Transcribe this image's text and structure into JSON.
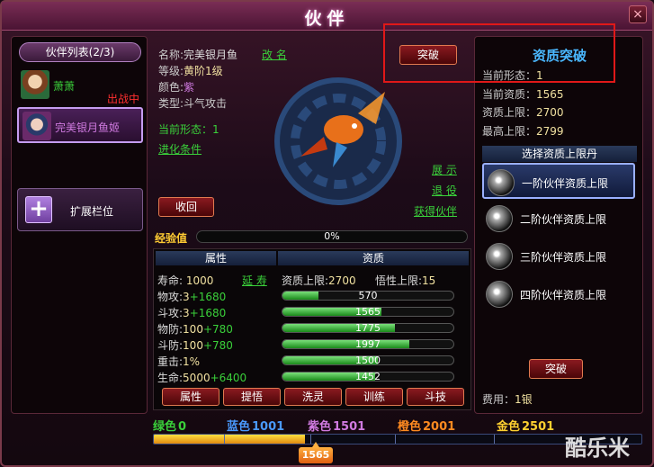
{
  "window": {
    "title": "伙伴",
    "close_glyph": "×"
  },
  "partner_list": {
    "header": "伙伴列表(2/3)",
    "items": [
      {
        "name": "萧萧",
        "name_color": "#3ad03a",
        "status": "出战中"
      },
      {
        "name": "完美银月鱼姬",
        "name_color": "#d07ae0",
        "status": ""
      }
    ],
    "expand_label": "扩展栏位"
  },
  "info": {
    "name_label": "名称:",
    "name": "完美银月鱼",
    "rename": "改 名",
    "level_label": "等级:",
    "level": "黄阶1级",
    "color_label": "颜色:",
    "color_value": "紫",
    "type_label": "类型:",
    "type_value": "斗气攻击",
    "form_label": "当前形态：",
    "form_value": "1",
    "evolve": "进化条件"
  },
  "buttons": {
    "breakthrough_top": "突破",
    "recall": "收回",
    "show": "展 示",
    "retire": "退 役",
    "get_partner": "获得伙伴"
  },
  "exp": {
    "label": "经验值",
    "value": "0%"
  },
  "table": {
    "col_attr": "属性",
    "col_aptitude": "资质",
    "life_span_label": "寿命:",
    "life_span": "1000",
    "extend": "延 寿",
    "cap_label": "资质上限:",
    "cap": "2700",
    "wisdom_label": "悟性上限:",
    "wisdom": "15",
    "rows": [
      {
        "label": "物攻:",
        "base": "3",
        "bonus": "+1680",
        "bar_value": "570",
        "fill": 0.21
      },
      {
        "label": "斗攻:",
        "base": "3",
        "bonus": "+1680",
        "bar_value": "1565",
        "fill": 0.58
      },
      {
        "label": "物防:",
        "base": "100",
        "bonus": "+780",
        "bar_value": "1775",
        "fill": 0.66
      },
      {
        "label": "斗防:",
        "base": "100",
        "bonus": "+780",
        "bar_value": "1997",
        "fill": 0.74
      },
      {
        "label": "重击:",
        "base": "1%",
        "bonus": "",
        "bar_value": "1500",
        "fill": 0.56
      },
      {
        "label": "生命:",
        "base": "5000",
        "bonus": "+6400",
        "bar_value": "1452",
        "fill": 0.54
      }
    ]
  },
  "tabs": [
    "属性",
    "提悟",
    "洗灵",
    "训练",
    "斗技"
  ],
  "aptitude_panel": {
    "title": "资质突破",
    "current_form_label": "当前形态：",
    "current_form": "1",
    "current_apt_label": "当前资质：",
    "current_apt": "1565",
    "apt_cap_label": "资质上限：",
    "apt_cap": "2700",
    "max_cap_label": "最高上限：",
    "max_cap": "2799",
    "select_header": "选择资质上限丹",
    "pills": [
      "一阶伙伴资质上限",
      "二阶伙伴资质上限",
      "三阶伙伴资质上限",
      "四阶伙伴资质上限"
    ],
    "breakthrough": "突破",
    "fee_label": "费用：",
    "fee": "1银"
  },
  "tiers": [
    {
      "name": "绿色",
      "value": "0",
      "color": "#3ad03a"
    },
    {
      "name": "蓝色",
      "value": "1001",
      "color": "#4a9aff"
    },
    {
      "name": "紫色",
      "value": "1501",
      "color": "#d07ae0"
    },
    {
      "name": "橙色",
      "value": "2001",
      "color": "#ff8a20"
    },
    {
      "name": "金色",
      "value": "2501",
      "color": "#ffd030"
    }
  ],
  "progress": {
    "value": "1565",
    "fill": 0.31
  },
  "watermark": "酷乐米"
}
